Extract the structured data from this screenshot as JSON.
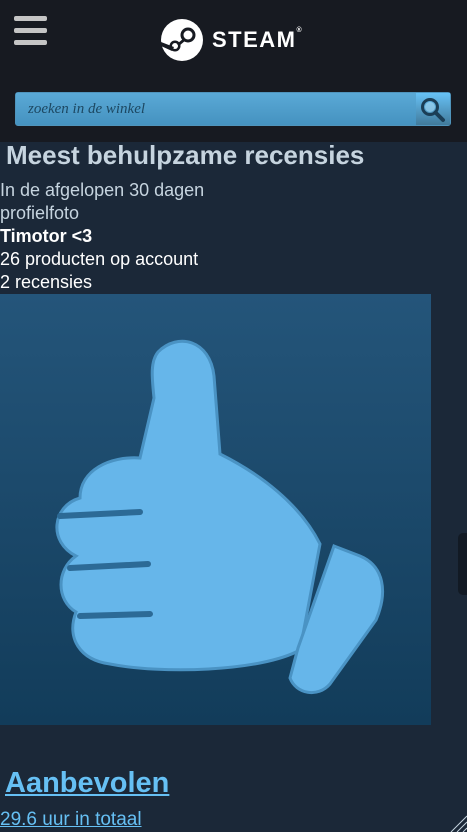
{
  "header": {
    "logo_text": "STEAM",
    "logo_mark": "®"
  },
  "search": {
    "placeholder": "zoeken in de winkel"
  },
  "main": {
    "heading": "Meest behulpzame recensies",
    "period": "In de afgelopen 30 dagen",
    "avatar_alt": "profielfoto",
    "reviewer_name": "Timotor <3",
    "products": "26 producten op account",
    "reviews": "2 recensies",
    "verdict": "Aanbevolen",
    "hours": "29.6 uur in totaal"
  },
  "colors": {
    "header_bg": "#171a21",
    "page_bg": "#1b2838",
    "link": "#66c0f4",
    "thumb": "#66b6ea"
  },
  "icons": {
    "menu": "hamburger-icon",
    "search": "search-icon",
    "logo": "steam-logo-icon",
    "thumb": "thumbs-up-icon"
  }
}
